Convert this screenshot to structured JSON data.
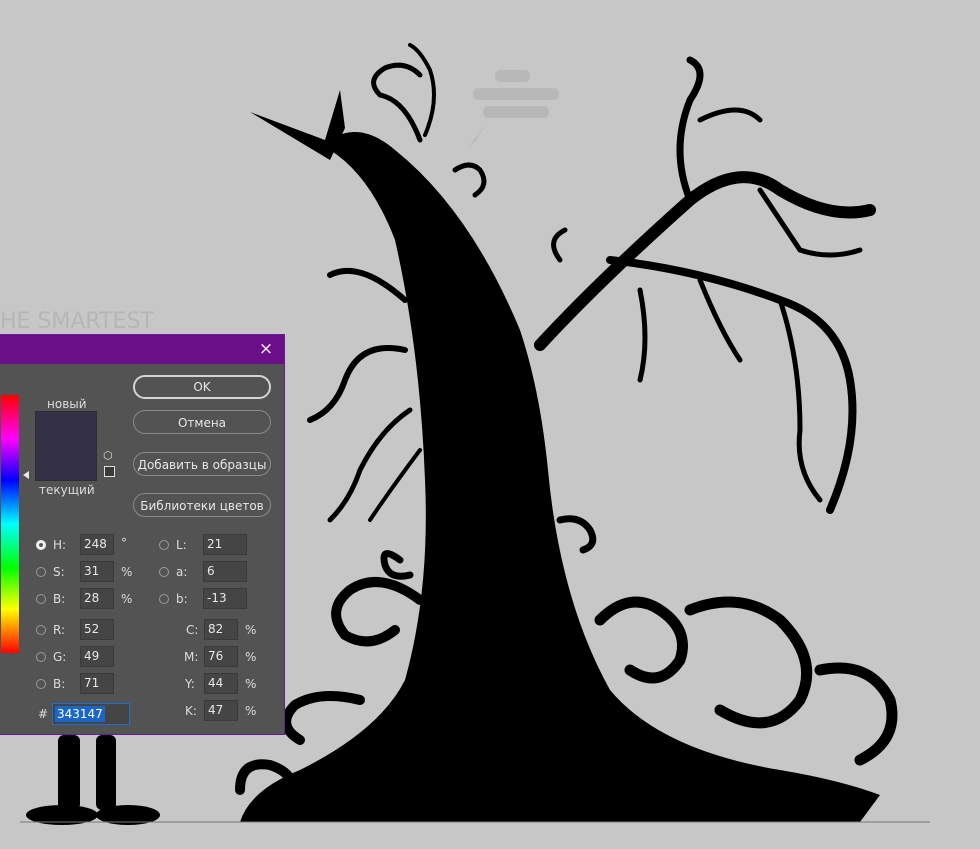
{
  "dialog": {
    "close_glyph": "×",
    "new_label": "новый",
    "current_label": "текущий",
    "buttons": {
      "ok": "OK",
      "cancel": "Отмена",
      "add_to_swatches": "Добавить в образцы",
      "color_libraries": "Библиотеки цветов"
    },
    "color_swatch": "#343147",
    "fields": {
      "H": {
        "label": "H:",
        "value": "248",
        "unit": "°"
      },
      "S": {
        "label": "S:",
        "value": "31",
        "unit": "%"
      },
      "B": {
        "label": "B:",
        "value": "28",
        "unit": "%"
      },
      "R": {
        "label": "R:",
        "value": "52"
      },
      "G": {
        "label": "G:",
        "value": "49"
      },
      "Bl": {
        "label": "B:",
        "value": "71"
      },
      "L": {
        "label": "L:",
        "value": "21"
      },
      "a": {
        "label": "a:",
        "value": "6"
      },
      "b": {
        "label": "b:",
        "value": "-13"
      },
      "C": {
        "label": "C:",
        "value": "82",
        "unit": "%"
      },
      "M": {
        "label": "M:",
        "value": "76",
        "unit": "%"
      },
      "Y": {
        "label": "Y:",
        "value": "44",
        "unit": "%"
      },
      "K": {
        "label": "K:",
        "value": "47",
        "unit": "%"
      }
    },
    "hex": {
      "label": "#",
      "value": "343147"
    }
  },
  "colors": {
    "background": "#c7c7c7",
    "titlebar": "#6b0f88",
    "dialog_body": "#535353",
    "selection": "#1a66c7"
  }
}
